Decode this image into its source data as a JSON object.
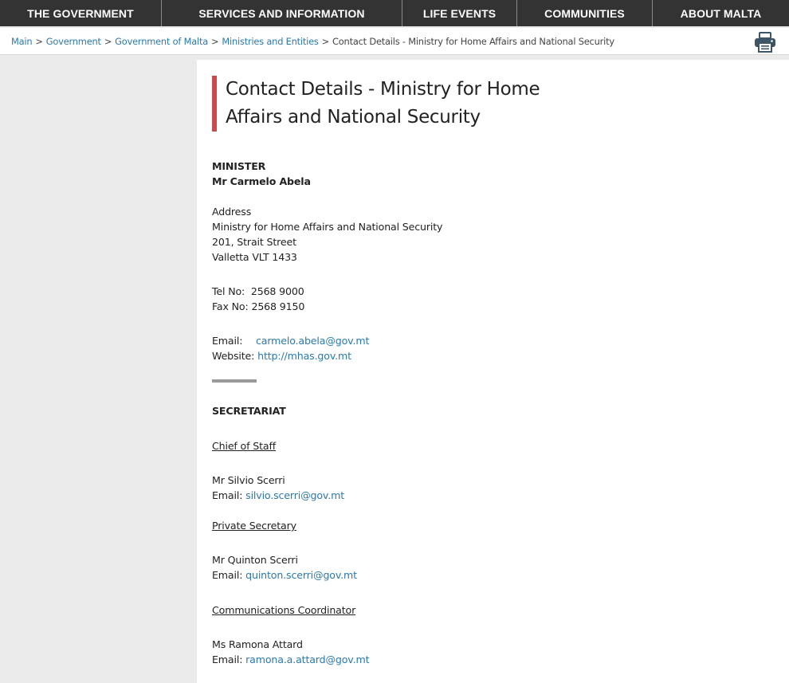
{
  "nav": {
    "items": [
      {
        "label": "THE GOVERNMENT"
      },
      {
        "label": "SERVICES AND INFORMATION"
      },
      {
        "label": "LIFE EVENTS"
      },
      {
        "label": "COMMUNITIES"
      },
      {
        "label": "ABOUT MALTA"
      }
    ]
  },
  "breadcrumb": {
    "items": [
      "Main",
      "Government",
      "Government of Malta",
      "Ministries and Entities"
    ],
    "separator": ">",
    "current": "Contact Details - Ministry for Home Affairs and National Security"
  },
  "print_icon": "printer-icon",
  "page": {
    "title_line1": "Contact Details - Ministry for Home",
    "title_line2": "Affairs and National Security"
  },
  "minister": {
    "heading": "MINISTER",
    "name": "Mr Carmelo Abela",
    "address_label": "Address",
    "address_line1": "Ministry for Home Affairs and National Security",
    "address_line2": "201, Strait Street",
    "address_line3": "Valletta VLT 1433",
    "tel_label": "Tel No:",
    "tel_value": "2568 9000",
    "fax_label": "Fax No:",
    "fax_value": "2568 9150",
    "email_label": "Email:",
    "email_value": "carmelo.abela@gov.mt",
    "website_label": "Website:",
    "website_value": "http://mhas.gov.mt"
  },
  "secretariat": {
    "heading": "SECRETARIAT",
    "roles": [
      {
        "role": "Chief of Staff",
        "name": "Mr Silvio Scerri",
        "email_label": "Email:",
        "email": "silvio.scerri@gov.mt"
      },
      {
        "role": "Private Secretary",
        "name": "Mr Quinton Scerri",
        "email_label": "Email:",
        "email": "quinton.scerri@gov.mt"
      },
      {
        "role": "Communications Coordinator",
        "name": "Ms Ramona Attard",
        "email_label": "Email:",
        "email": "ramona.a.attard@gov.mt"
      }
    ]
  },
  "colors": {
    "nav_bg": "#333333",
    "accent_bar": "#c9494f",
    "link": "#2a7ab0",
    "sidebar_bg": "#ebebeb"
  }
}
